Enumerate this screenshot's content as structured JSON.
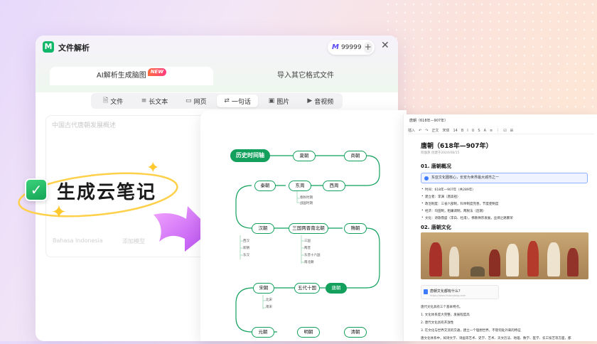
{
  "app": {
    "title": "文件解析",
    "credits": "99999",
    "plus": "+",
    "close": "✕",
    "tabs": [
      {
        "label": "AI解析生成脑图",
        "badge": "NEW"
      },
      {
        "label": "导入其它格式文件"
      }
    ],
    "source_types": [
      {
        "icon": "file-icon",
        "label": "文件"
      },
      {
        "icon": "long-text-icon",
        "label": "长文本"
      },
      {
        "icon": "webpage-icon",
        "label": "网页"
      },
      {
        "icon": "sentence-icon",
        "label": "一句话",
        "selected": true
      },
      {
        "icon": "image-icon",
        "label": "图片"
      },
      {
        "icon": "video-icon",
        "label": "音视频"
      }
    ],
    "input_placeholder": "中国古代唐朝发展概述",
    "model_label": "Bahasa Indonesia",
    "extra_label": "添加模型"
  },
  "banner": {
    "text": "生成云笔记"
  },
  "mindmap": {
    "root": "历史时间轴",
    "row1": [
      "夏朝",
      "商朝"
    ],
    "row2": [
      "秦朝",
      "东周",
      "西周"
    ],
    "dongzhou_children": [
      "春秋时期",
      "战国时期"
    ],
    "row3": [
      "汉朝",
      "三国两晋南北朝",
      "隋朝"
    ],
    "han_children": [
      "西汉",
      "新朝",
      "东汉"
    ],
    "sanguo_children": [
      "三国",
      "两晋",
      "东晋十六国",
      "南北朝"
    ],
    "row4": [
      "宋朝",
      "五代十国",
      "唐朝"
    ],
    "song_children": [
      "北宋",
      "南宋"
    ],
    "row5": [
      "元朝",
      "明朝",
      "清朝"
    ],
    "accent_color": "#12a05c"
  },
  "doc": {
    "breadcrumb": "唐朝（618年—907年）",
    "toolbar": [
      "插入",
      "↶",
      "↷",
      "正文",
      "宋体",
      "14",
      "B",
      "I",
      "U",
      "S",
      "A",
      "≡",
      "⋮",
      "☑",
      "⊞"
    ],
    "title": "唐朝（618年—907年）",
    "meta": "阿伽蒸  创建于2024/08/15",
    "sections": [
      {
        "heading": "01. 唐朝概况",
        "callout": "东亚文化圈核心，长安为世界最大城市之一",
        "items": [
          "时间：618年—907年（共289年）",
          "建立者：李渊（唐高祖）",
          "政治制度：三省六部制，科举制度完善，节度使制度",
          "经济：均田制，租庸调制，两税法（后期）",
          "文化：诗歌鼎盛（李白、杜甫），佛教禅宗发展，丝绸之路繁荣"
        ]
      },
      {
        "heading": "02. 唐朝文化",
        "link_title": "唐朝文化都有什么？",
        "link_url": "https://www.historyblog.com",
        "paragraphs": [
          "唐代文化具有三个基本特点。",
          "1.  文化体系庞大完整，发展程度高",
          "2.  唐代文化具有开放性",
          "3.  在文化与世界交流的交通，建立一个理想世界，不管何处外来的特征",
          "唐文化体系中，如诗文学、诗画等艺术、史学、艺术、天文历法、地理、数学、医学、农工技艺等方面，都"
        ]
      }
    ]
  }
}
